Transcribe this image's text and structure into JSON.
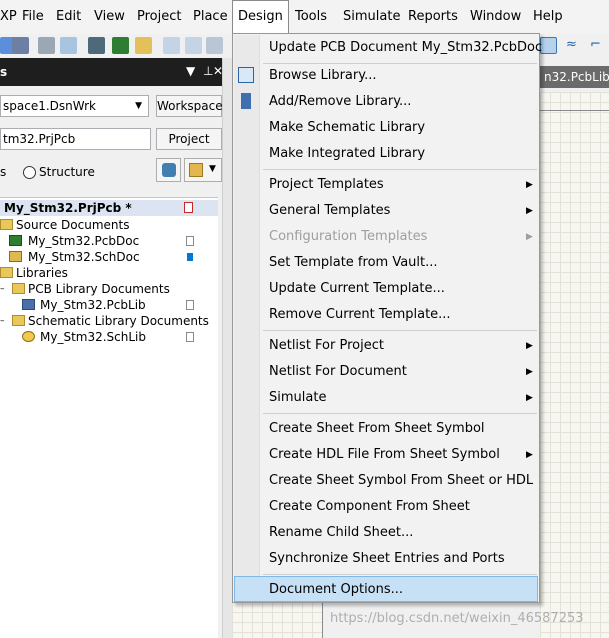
{
  "menubar": {
    "items": [
      {
        "label": "XP"
      },
      {
        "label": "File"
      },
      {
        "label": "Edit"
      },
      {
        "label": "View"
      },
      {
        "label": "Project"
      },
      {
        "label": "Place"
      },
      {
        "label": "Design"
      },
      {
        "label": "Tools"
      },
      {
        "label": "Simulate"
      },
      {
        "label": "Reports"
      },
      {
        "label": "Window"
      },
      {
        "label": "Help"
      }
    ]
  },
  "panel": {
    "title": "s",
    "workspace_combo": "space1.DsnWrk",
    "workspace_button": "Workspace",
    "project_field": "tm32.PrjPcb",
    "project_button": "Project",
    "view_left_label": "s",
    "structure_label": "Structure"
  },
  "tree": {
    "project": "My_Stm32.PrjPcb *",
    "source_documents": "Source Documents",
    "pcbdoc": "My_Stm32.PcbDoc",
    "schdoc": "My_Stm32.SchDoc",
    "libraries": "Libraries",
    "pcb_lib_docs": "PCB Library Documents",
    "pcblib": "My_Stm32.PcbLib",
    "sch_lib_docs": "Schematic Library Documents",
    "schlib": "My_Stm32.SchLib"
  },
  "doc_tab": "n32.PcbLib",
  "design_menu": {
    "items": [
      {
        "label": "Update PCB Document My_Stm32.PcbDoc"
      },
      {
        "label": "Browse Library..."
      },
      {
        "label": "Add/Remove Library..."
      },
      {
        "label": "Make Schematic Library"
      },
      {
        "label": "Make Integrated Library"
      },
      {
        "label": "Project Templates"
      },
      {
        "label": "General Templates"
      },
      {
        "label": "Configuration Templates"
      },
      {
        "label": "Set Template from Vault..."
      },
      {
        "label": "Update Current Template..."
      },
      {
        "label": "Remove Current Template..."
      },
      {
        "label": "Netlist For Project"
      },
      {
        "label": "Netlist For Document"
      },
      {
        "label": "Simulate"
      },
      {
        "label": "Create Sheet From Sheet Symbol"
      },
      {
        "label": "Create HDL File From Sheet Symbol"
      },
      {
        "label": "Create Sheet Symbol From Sheet or HDL"
      },
      {
        "label": "Create Component From Sheet"
      },
      {
        "label": "Rename Child Sheet..."
      },
      {
        "label": "Synchronize Sheet Entries and Ports"
      },
      {
        "label": "Document Options..."
      }
    ]
  },
  "watermark": "https://blog.csdn.net/weixin_46587253",
  "colors": {
    "selection": "#0078d7",
    "menu_highlight": "#c6e0f5",
    "panel_header": "#1e1e1e"
  }
}
